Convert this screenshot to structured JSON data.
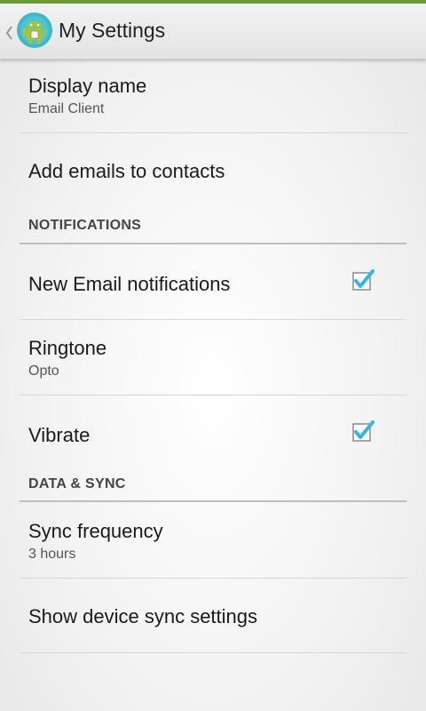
{
  "actionbar": {
    "title": "My Settings"
  },
  "prefs": {
    "display_name": {
      "label": "Display name",
      "summary": "Email Client"
    },
    "add_emails": {
      "label": "Add emails to contacts"
    },
    "notifications_header": "NOTIFICATIONS",
    "new_email": {
      "label": "New Email notifications",
      "checked": true
    },
    "ringtone": {
      "label": "Ringtone",
      "summary": "Opto"
    },
    "vibrate": {
      "label": "Vibrate",
      "checked": true
    },
    "data_sync_header": "DATA & SYNC",
    "sync_frequency": {
      "label": "Sync frequency",
      "summary": "3 hours"
    },
    "device_sync": {
      "label": "Show device sync settings"
    }
  },
  "colors": {
    "accent": "#33b5e5",
    "status_stripe": "#6e9b3a"
  }
}
